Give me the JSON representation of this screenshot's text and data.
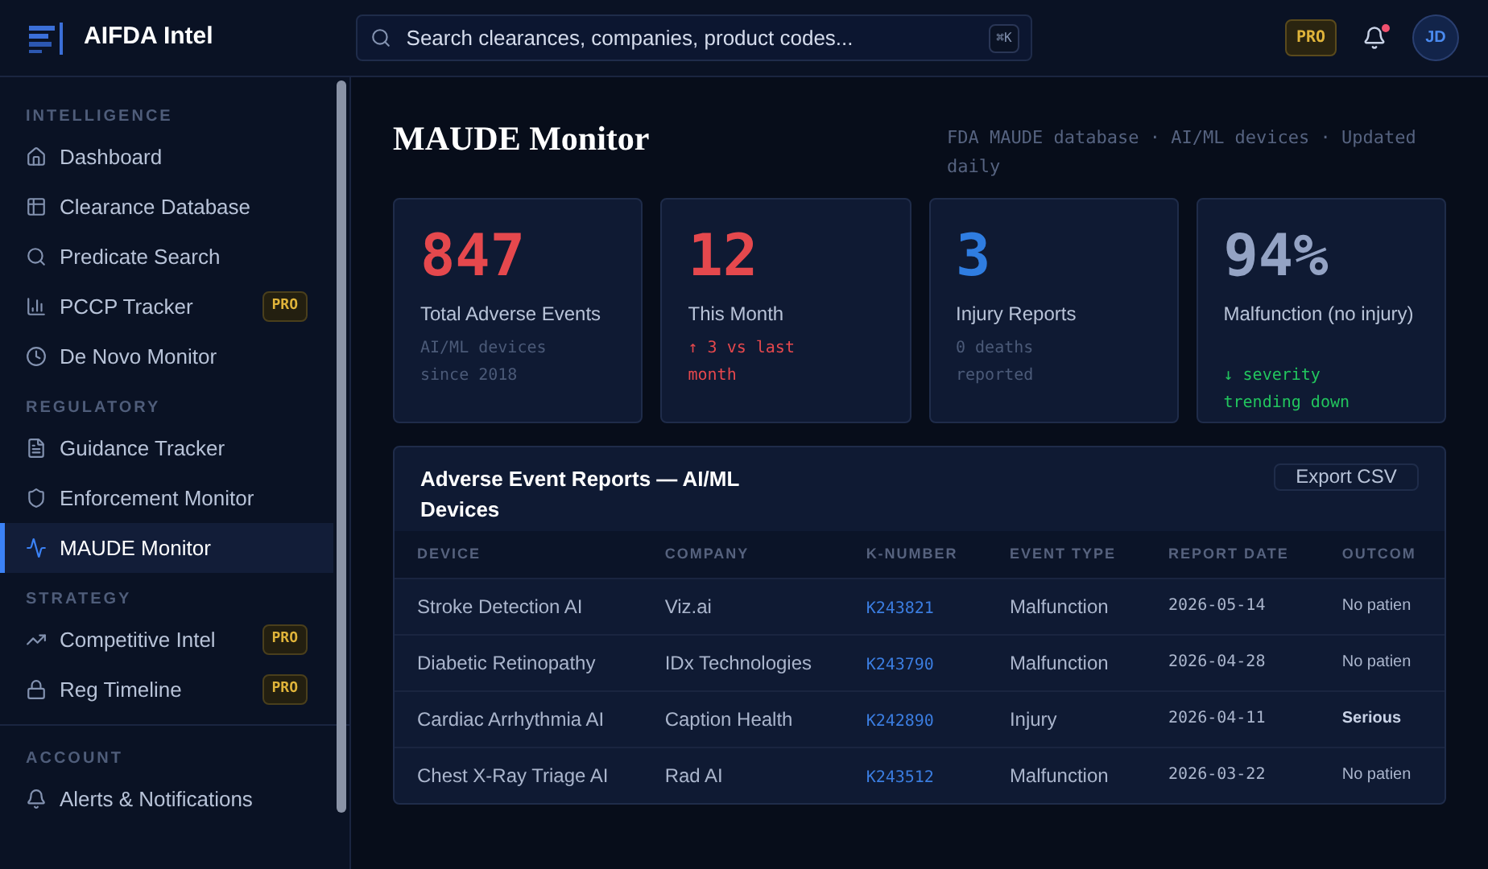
{
  "brand": {
    "name": "AIFDA Intel"
  },
  "search": {
    "placeholder": "Search clearances, companies, product codes...",
    "shortcut": "⌘K"
  },
  "header": {
    "plan_badge": "PRO",
    "notifications_unread": true,
    "avatar": "JD"
  },
  "sidebar": {
    "sections": [
      {
        "title": "INTELLIGENCE",
        "items": [
          {
            "label": "Dashboard",
            "selected": false
          },
          {
            "label": "Clearance Database",
            "selected": false
          },
          {
            "label": "Predicate Search",
            "selected": false
          },
          {
            "label": "PCCP Tracker",
            "selected": false,
            "badge": "PRO"
          },
          {
            "label": "De Novo Monitor",
            "selected": false
          }
        ]
      },
      {
        "title": "REGULATORY",
        "items": [
          {
            "label": "Guidance Tracker",
            "selected": false
          },
          {
            "label": "Enforcement Monitor",
            "selected": false
          },
          {
            "label": "MAUDE Monitor",
            "selected": true
          }
        ]
      },
      {
        "title": "STRATEGY",
        "items": [
          {
            "label": "Competitive Intel",
            "selected": false,
            "badge": "PRO"
          },
          {
            "label": "Reg Timeline",
            "selected": false,
            "badge": "PRO"
          }
        ]
      },
      {
        "title": "ACCOUNT",
        "items": [
          {
            "label": "Alerts & Notifications",
            "selected": false
          }
        ]
      }
    ]
  },
  "page": {
    "title": "MAUDE Monitor",
    "subtitle": "FDA MAUDE database · AI/ML devices · Updated daily"
  },
  "stats": [
    {
      "value": "847",
      "label": "Total Adverse Events",
      "note": "AI/ML devices since 2018",
      "color": "#e5484d"
    },
    {
      "value": "12",
      "label": "This Month",
      "note": "↑ 3 vs last month",
      "color": "#e5484d"
    },
    {
      "value": "3",
      "label": "Injury Reports",
      "note": "0 deaths reported",
      "color": "#2f7de1"
    },
    {
      "value": "94%",
      "label": "Malfunction (no injury)",
      "note": "↓ severity trending down",
      "color": "#94a3c4"
    }
  ],
  "table": {
    "title": "Adverse Event Reports — AI/ML Devices",
    "export_button": "Export CSV",
    "columns": [
      "DEVICE",
      "COMPANY",
      "K-NUMBER",
      "EVENT TYPE",
      "REPORT DATE",
      "OUTCOM"
    ],
    "rows": [
      {
        "device": "Stroke Detection AI",
        "company": "Viz.ai",
        "k_number": "K243821",
        "event_type": "Malfunction",
        "report_date": "2026-05-14",
        "outcome": "No patien",
        "serious": false
      },
      {
        "device": "Diabetic Retinopathy",
        "company": "IDx Technologies",
        "k_number": "K243790",
        "event_type": "Malfunction",
        "report_date": "2026-04-28",
        "outcome": "No patien",
        "serious": false
      },
      {
        "device": "Cardiac Arrhythmia AI",
        "company": "Caption Health",
        "k_number": "K242890",
        "event_type": "Injury",
        "report_date": "2026-04-11",
        "outcome": "Serious",
        "serious": true
      },
      {
        "device": "Chest X-Ray Triage AI",
        "company": "Rad AI",
        "k_number": "K243512",
        "event_type": "Malfunction",
        "report_date": "2026-03-22",
        "outcome": "No patien",
        "serious": false
      }
    ]
  }
}
